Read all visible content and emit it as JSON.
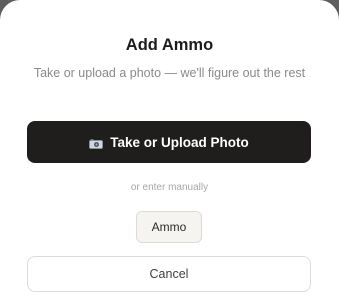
{
  "modal": {
    "title": "Add Ammo",
    "subtitle": "Take or upload a photo — we'll figure out the rest",
    "primary_button_label": "Take or Upload Photo",
    "primary_button_icon": "camera-icon",
    "divider_text": "or enter manually",
    "ammo_button_label": "Ammo",
    "cancel_button_label": "Cancel"
  },
  "colors": {
    "primary_button_bg": "#1f1e1c",
    "backdrop": "#5e5e5e",
    "chip_bg": "#f6f4f0"
  }
}
